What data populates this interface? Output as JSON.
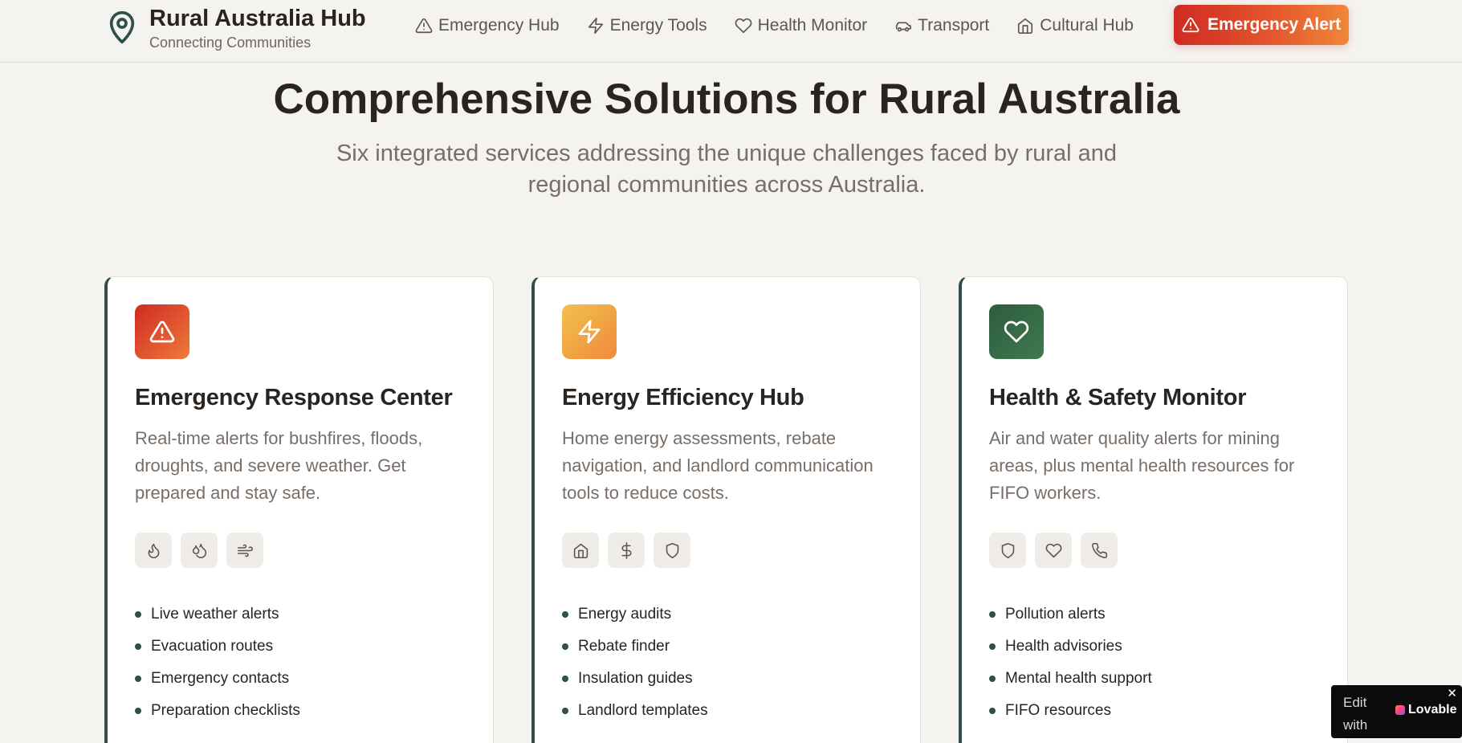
{
  "brand": {
    "title": "Rural Australia Hub",
    "subtitle": "Connecting Communities",
    "icon": "map-pin-icon"
  },
  "nav": {
    "items": [
      {
        "label": "Emergency Hub",
        "icon": "alert-triangle-icon"
      },
      {
        "label": "Energy Tools",
        "icon": "zap-icon"
      },
      {
        "label": "Health Monitor",
        "icon": "heart-icon"
      },
      {
        "label": "Transport",
        "icon": "car-icon"
      },
      {
        "label": "Cultural Hub",
        "icon": "home-icon"
      }
    ],
    "alert_button": "Emergency Alert"
  },
  "hero": {
    "title": "Comprehensive Solutions for Rural Australia",
    "subtitle": "Six integrated services addressing the unique challenges faced by rural and regional communities across Australia."
  },
  "cards": [
    {
      "title": "Emergency Response Center",
      "description": "Real-time alerts for bushfires, floods, droughts, and severe weather. Get prepared and stay safe.",
      "icon": "alert-triangle-icon",
      "chips": [
        "flame-icon",
        "droplets-icon",
        "wind-icon"
      ],
      "features": [
        "Live weather alerts",
        "Evacuation routes",
        "Emergency contacts",
        "Preparation checklists"
      ]
    },
    {
      "title": "Energy Efficiency Hub",
      "description": "Home energy assessments, rebate navigation, and landlord communication tools to reduce costs.",
      "icon": "zap-icon",
      "chips": [
        "home-icon",
        "dollar-icon",
        "shield-icon"
      ],
      "features": [
        "Energy audits",
        "Rebate finder",
        "Insulation guides",
        "Landlord templates"
      ]
    },
    {
      "title": "Health & Safety Monitor",
      "description": "Air and water quality alerts for mining areas, plus mental health resources for FIFO workers.",
      "icon": "heart-icon",
      "chips": [
        "shield-icon",
        "heart-icon",
        "phone-icon"
      ],
      "features": [
        "Pollution alerts",
        "Health advisories",
        "Mental health support",
        "FIFO resources"
      ]
    }
  ],
  "badge": {
    "edit_text": "Edit with",
    "logo_text": "Lovable",
    "close": "✕"
  },
  "colors": {
    "background": "#f5f3f0",
    "accent_dark": "#2f4f4a",
    "emergency_gradient": [
      "#cf2a23",
      "#f0873a"
    ],
    "energy_gradient": [
      "#f2c14e",
      "#ef8a3b"
    ],
    "health_gradient": [
      "#2e5b3f",
      "#3f7a4e"
    ]
  }
}
